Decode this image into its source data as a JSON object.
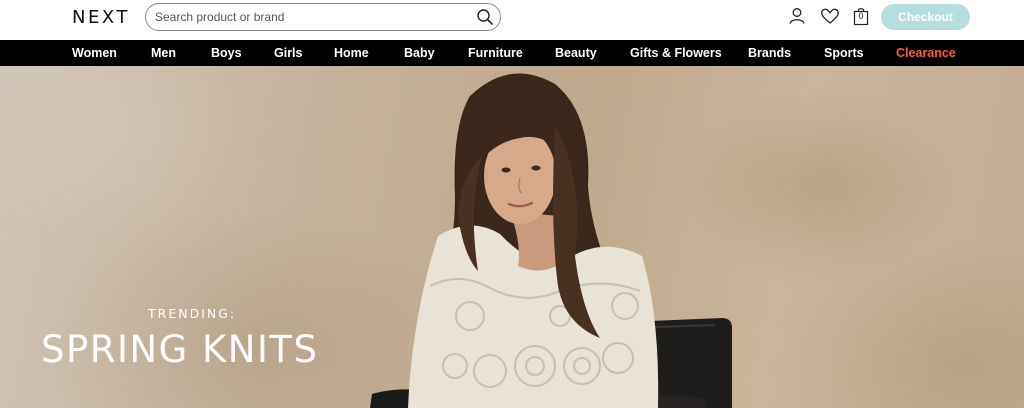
{
  "header": {
    "logo": "NEXT",
    "search": {
      "placeholder": "Search product or brand",
      "value": ""
    },
    "bag_count": "0",
    "checkout_label": "Checkout",
    "icons": [
      "search-icon",
      "account-icon",
      "heart-icon",
      "bag-icon"
    ]
  },
  "nav": {
    "items": [
      {
        "label": "Women"
      },
      {
        "label": "Men"
      },
      {
        "label": "Boys"
      },
      {
        "label": "Girls"
      },
      {
        "label": "Home"
      },
      {
        "label": "Baby"
      },
      {
        "label": "Furniture"
      },
      {
        "label": "Beauty"
      },
      {
        "label": "Gifts & Flowers"
      },
      {
        "label": "Brands"
      },
      {
        "label": "Sports"
      },
      {
        "label": "Clearance"
      }
    ]
  },
  "hero": {
    "kicker": "TRENDING:",
    "title": "SPRING KNITS"
  },
  "colors": {
    "nav_background": "#000000",
    "clearance": "#ff5a3c",
    "checkout_button": "#b7dede"
  }
}
